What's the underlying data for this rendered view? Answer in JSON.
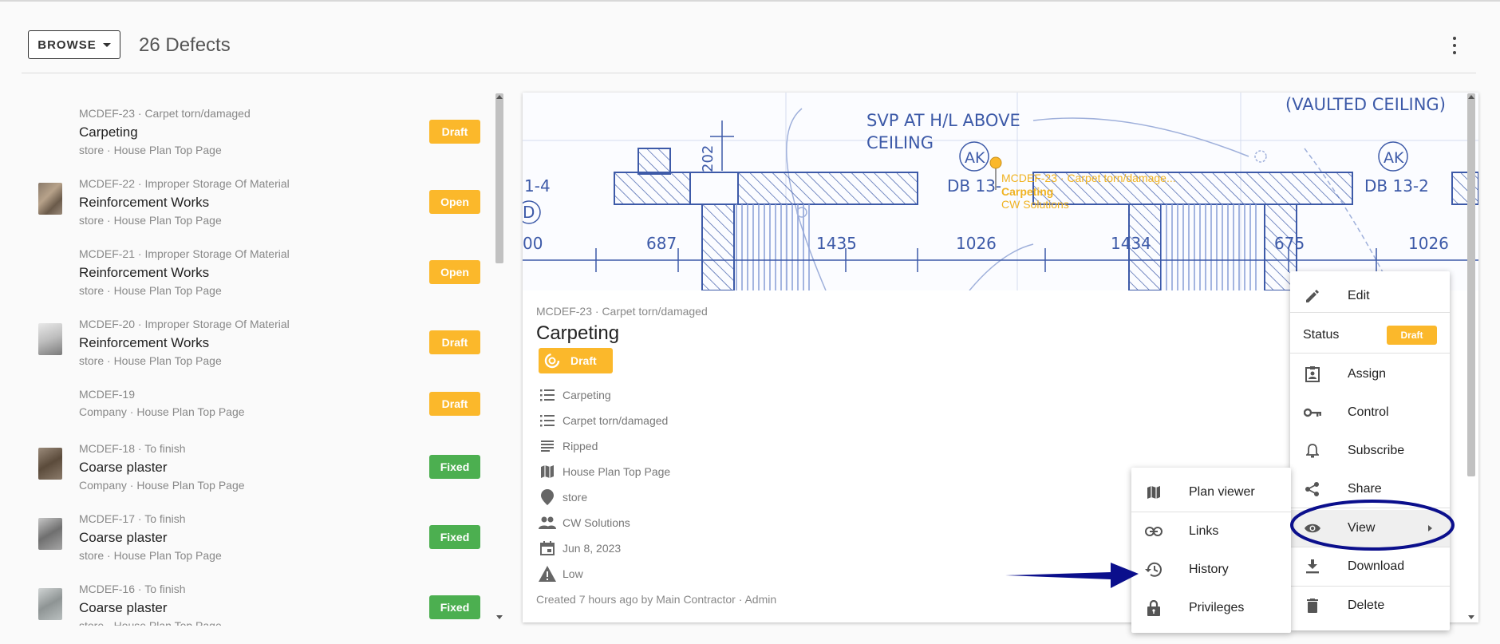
{
  "header": {
    "browse_label": "BROWSE",
    "title": "26 Defects"
  },
  "items": [
    {
      "meta": "MCDEF-23 · Carpet torn/damaged",
      "title": "Carpeting",
      "sub": "store · House Plan Top Page",
      "status": "Draft",
      "has_thumb": false
    },
    {
      "meta": "MCDEF-22 · Improper Storage Of Material",
      "title": "Reinforcement Works",
      "sub": "store · House Plan Top Page",
      "status": "Open",
      "has_thumb": true
    },
    {
      "meta": "MCDEF-21 · Improper Storage Of Material",
      "title": "Reinforcement Works",
      "sub": "store · House Plan Top Page",
      "status": "Open",
      "has_thumb": false
    },
    {
      "meta": "MCDEF-20 · Improper Storage Of Material",
      "title": "Reinforcement Works",
      "sub": "store · House Plan Top Page",
      "status": "Draft",
      "has_thumb": true
    },
    {
      "meta": "MCDEF-19",
      "title": "",
      "sub": "Company · House Plan Top Page",
      "status": "Draft",
      "has_thumb": false
    },
    {
      "meta": "MCDEF-18 · To finish",
      "title": "Coarse plaster",
      "sub": "Company · House Plan Top Page",
      "status": "Fixed",
      "has_thumb": true
    },
    {
      "meta": "MCDEF-17 · To finish",
      "title": "Coarse plaster",
      "sub": "store · House Plan Top Page",
      "status": "Fixed",
      "has_thumb": true
    },
    {
      "meta": "MCDEF-16 · To finish",
      "title": "Coarse plaster",
      "sub": "store · House Plan Top Page",
      "status": "Fixed",
      "has_thumb": true
    }
  ],
  "plan": {
    "note1": "SVP AT H/L ABOVE",
    "note2": "CEILING",
    "vaulted": "(VAULTED CEILING)",
    "ak1": "AK",
    "ak2": "AK",
    "db1": "DB 13-",
    "db2": "DB 13-2",
    "dim_202": "202",
    "dim_00": "00",
    "dim_687": "687",
    "dim_1435": "1435",
    "dim_1026a": "1026",
    "dim_1434": "1434",
    "dim_675": "675",
    "dim_1026b": "1026",
    "left_1_4": "1-4",
    "left_d": "D",
    "pin_line1": "MCDEF-23 · Carpet torn/damage...",
    "pin_line2": "Carpeting",
    "pin_line3": "CW Solutions"
  },
  "detail": {
    "meta": "MCDEF-23 · Carpet torn/damaged",
    "title": "Carpeting",
    "status": "Draft",
    "props": [
      {
        "icon": "list-icon",
        "text": "Carpeting"
      },
      {
        "icon": "list-icon",
        "text": "Carpet torn/damaged"
      },
      {
        "icon": "description-icon",
        "text": "Ripped"
      },
      {
        "icon": "map-icon",
        "text": "House Plan Top Page"
      },
      {
        "icon": "location-pin-icon",
        "text": "store"
      },
      {
        "icon": "people-icon",
        "text": "CW Solutions"
      },
      {
        "icon": "calendar-icon",
        "text": "Jun 8, 2023"
      },
      {
        "icon": "warning-icon",
        "text": "Low"
      }
    ],
    "created": "Created 7 hours ago by Main Contractor · Admin"
  },
  "context_menu": {
    "edit": "Edit",
    "status_label": "Status",
    "status_value": "Draft",
    "assign": "Assign",
    "control": "Control",
    "subscribe": "Subscribe",
    "share": "Share",
    "view": "View",
    "download": "Download",
    "delete": "Delete"
  },
  "submenu": {
    "plan_viewer": "Plan viewer",
    "links": "Links",
    "history": "History",
    "privileges": "Privileges"
  },
  "colors": {
    "draft": "#fbb82b",
    "fixed": "#4caf50",
    "annotation": "#0b0f8c",
    "plan_line": "#3d5aa8"
  }
}
